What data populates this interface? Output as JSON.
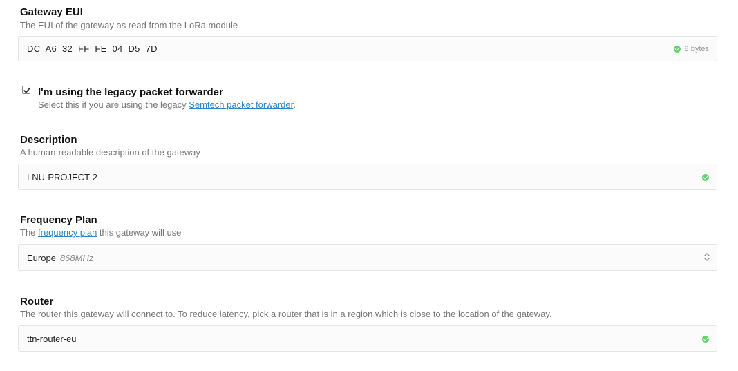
{
  "gateway_eui": {
    "label": "Gateway EUI",
    "hint": "The EUI of the gateway as read from the LoRa module",
    "value": "DC A6 32 FF FE 04 D5 7D",
    "byte_count": "8 bytes"
  },
  "legacy_forwarder": {
    "checked": true,
    "label": "I'm using the legacy packet forwarder",
    "hint_prefix": "Select this if you are using the legacy ",
    "hint_link": "Semtech packet forwarder",
    "hint_suffix": "."
  },
  "description": {
    "label": "Description",
    "hint": "A human-readable description of the gateway",
    "value": "LNU-PROJECT-2"
  },
  "frequency_plan": {
    "label": "Frequency Plan",
    "hint_prefix": "The ",
    "hint_link": "frequency plan",
    "hint_suffix": " this gateway will use",
    "selected_region": "Europe",
    "selected_band": "868MHz"
  },
  "router": {
    "label": "Router",
    "hint": "The router this gateway will connect to. To reduce latency, pick a router that is in a region which is close to the location of the gateway.",
    "value": "ttn-router-eu"
  },
  "colors": {
    "valid": "#5cd66a",
    "link": "#2a86c9"
  }
}
